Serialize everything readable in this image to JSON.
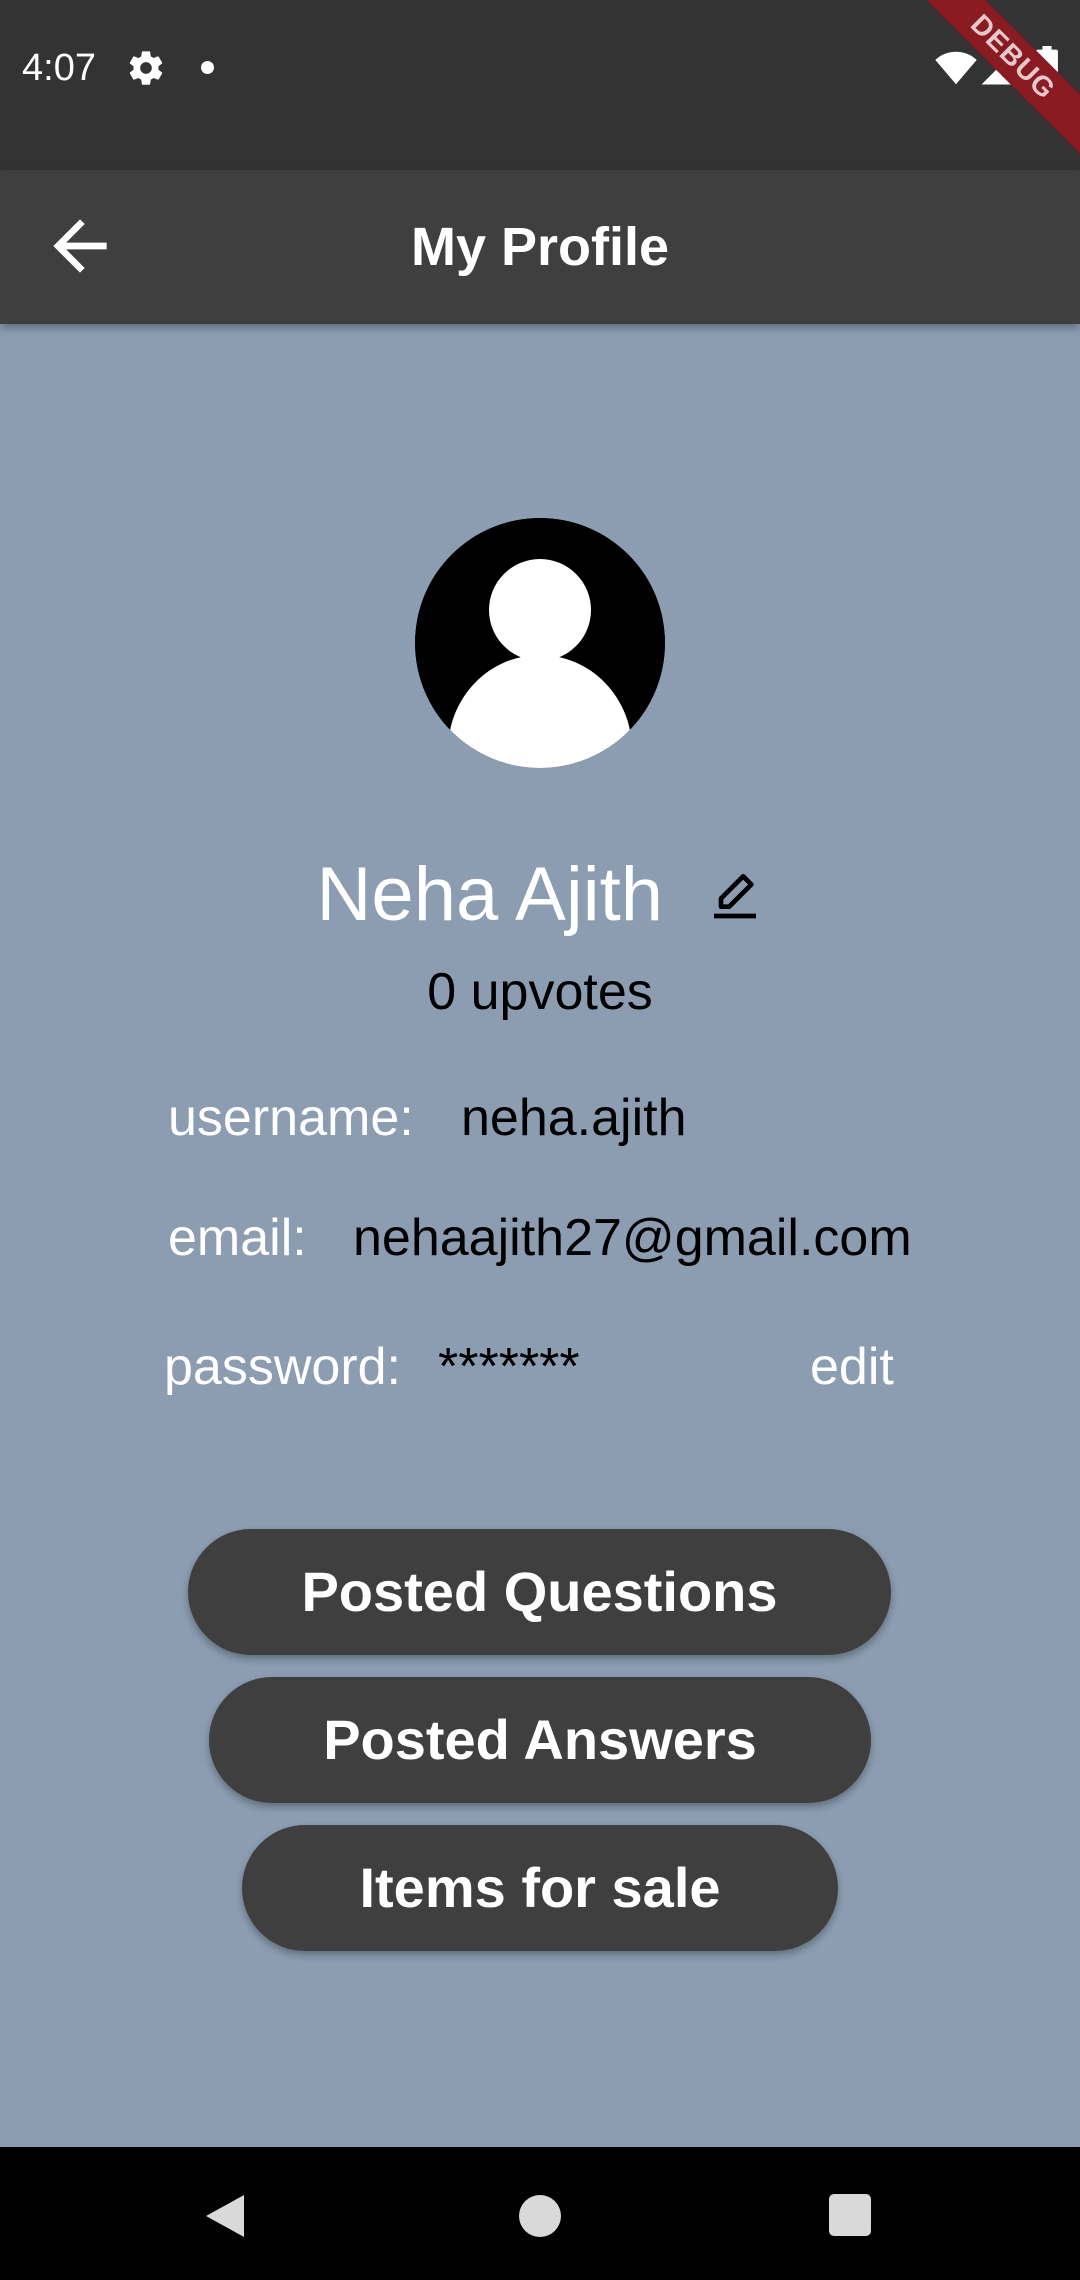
{
  "status_bar": {
    "time": "4:07",
    "debug_banner": "DEBUG"
  },
  "app_bar": {
    "title": "My Profile"
  },
  "profile": {
    "name": "Neha Ajith",
    "upvotes": "0 upvotes",
    "username_label": "username:",
    "username_value": "neha.ajith",
    "email_label": "email:",
    "email_value": "nehaajith27@gmail.com",
    "password_label": "password:",
    "password_value": "*******",
    "password_edit": "edit"
  },
  "actions": {
    "posted_questions": "Posted Questions",
    "posted_answers": "Posted Answers",
    "items_for_sale": "Items for sale"
  },
  "colors": {
    "background": "#8c9db2",
    "app_bar": "#3f3f3f",
    "status_bar": "#333333",
    "button": "#3f3f3f",
    "debug_banner": "#8a1b22"
  },
  "icons": [
    "gear-icon",
    "wifi-icon",
    "signal-icon",
    "battery-icon",
    "back-arrow-icon",
    "avatar-person-icon",
    "pencil-edit-icon",
    "nav-back-icon",
    "nav-home-icon",
    "nav-recents-icon"
  ]
}
